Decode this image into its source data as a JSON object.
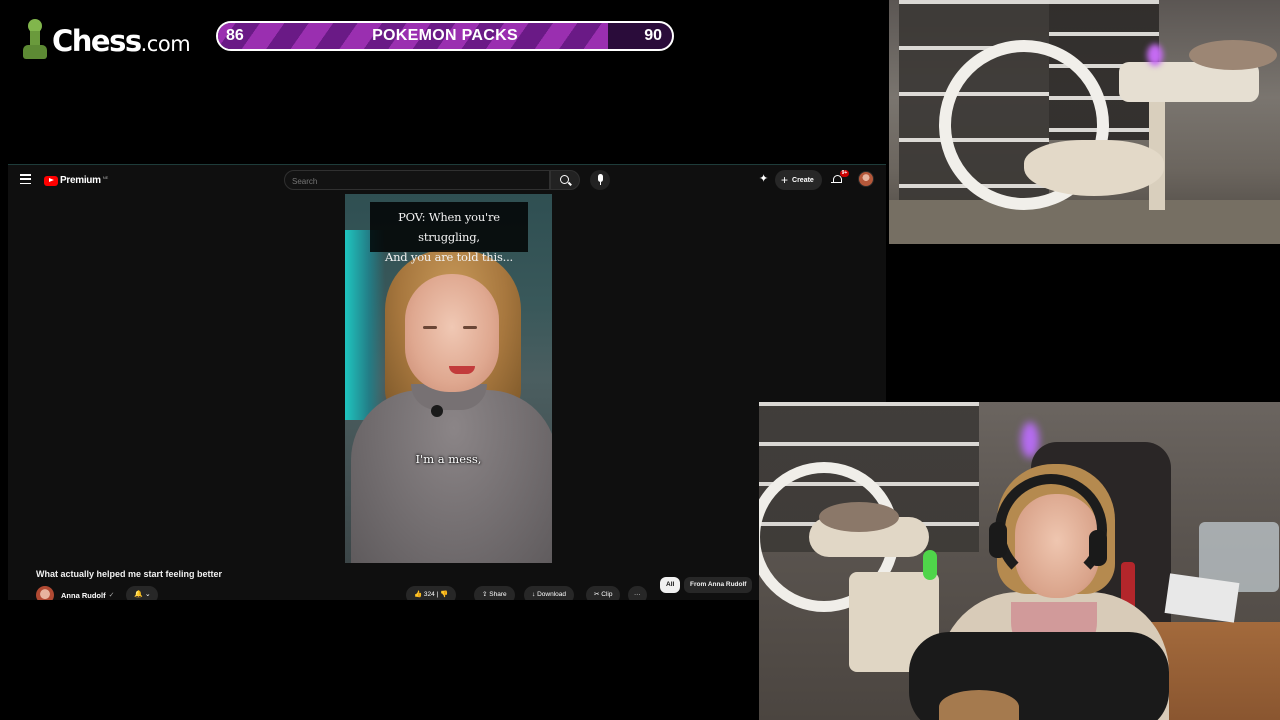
{
  "overlay": {
    "brand": {
      "name": "Chess",
      "tld": ".com"
    },
    "goal": {
      "label": "POKEMON PACKS",
      "start": "86",
      "end": "90",
      "progress": 0.86,
      "colors": {
        "stripe_a": "#9a2fb0",
        "stripe_b": "#6a1a86",
        "track": "#2a0c3a"
      }
    }
  },
  "youtube": {
    "brand": {
      "label": "Premium",
      "superscript": "NE"
    },
    "search": {
      "placeholder": "Search"
    },
    "create_label": "Create",
    "notifications_badge": "9+",
    "video": {
      "caption_top_line1": "POV: When you're struggling,",
      "caption_top_line2": "And you are told this...",
      "caption_mid": "I'm a mess,",
      "title": "What actually helped me start feeling better"
    },
    "channel": {
      "name": "Anna Rudolf",
      "subscribe_label": "🔔 ⌄"
    },
    "actions": {
      "likes": "324",
      "share": "Share",
      "download": "Download",
      "clip": "Clip",
      "more": "···"
    },
    "chips": {
      "all": "All",
      "from_channel": "From Anna Rudolf"
    },
    "colors": {
      "accent": "#ff0000",
      "background": "#0f0f0f",
      "pill": "#272727"
    }
  }
}
